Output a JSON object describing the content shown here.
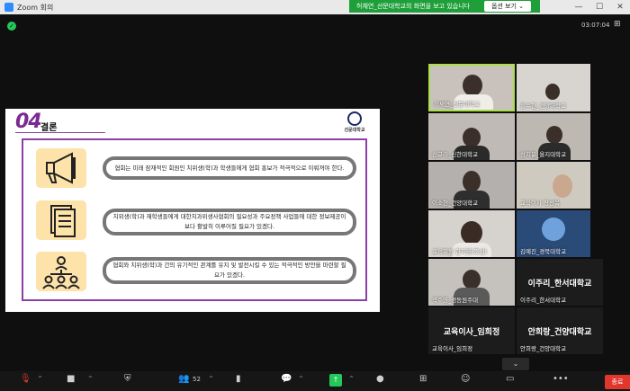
{
  "window": {
    "title": "Zoom 회의",
    "minimize": "—",
    "maximize": "☐",
    "close": "✕"
  },
  "share_banner": {
    "text": "허채연_선문대학교의 화면을 보고 있습니다",
    "button": "옵션 보기 ⌄"
  },
  "meeting": {
    "timer": "03:07:04",
    "grid_glyph": "⊞"
  },
  "slide": {
    "number": "04",
    "title": "결론",
    "logo_text": "선문대학교",
    "rows": [
      {
        "icon": "megaphone-icon",
        "text": "협회는 미래 잠재적인 회원인 치위생(학)과 학생들에게 협회 홍보가 적극적으로 이뤄져야 한다."
      },
      {
        "icon": "document-icon",
        "text": "치위생(학)과 재학생들에게 대한치과위생사협회의 필요성과 주요정책 사업들에 대한 정보제공이 보다 활발히 이루어질 필요가 있겠다."
      },
      {
        "icon": "network-icon",
        "text": "협회와 치위생(학)과 간의 유기적인 관계를 유지 및 발전시킬 수 있는 적극적인 방안을 마련할 필요가 있겠다."
      }
    ]
  },
  "participants": [
    {
      "name": "허채연_선문대학교",
      "video": true,
      "active": true
    },
    {
      "name": "홍수현_건양대학교",
      "video": true
    },
    {
      "name": "신규리_신한대학교",
      "video": true
    },
    {
      "name": "성지윤_을지대학교",
      "video": true
    },
    {
      "name": "이소현_건양대학교",
      "video": true
    },
    {
      "name": "교육이사 장선옥",
      "video": true
    },
    {
      "name": "교육위원 한지영(조선)",
      "video": true
    },
    {
      "name": "김예진_경북대학교",
      "video": true
    },
    {
      "name": "곽주영_경동원주대",
      "video": true
    },
    {
      "name": "이주리_한서대학교",
      "video": false
    },
    {
      "name": "교육이사_임희정",
      "video": false
    },
    {
      "name": "안희랑_건양대학교",
      "video": false
    }
  ],
  "toolbar": {
    "participants_count": "52",
    "leave_label": "종료",
    "collapse_glyph": "⌄"
  }
}
